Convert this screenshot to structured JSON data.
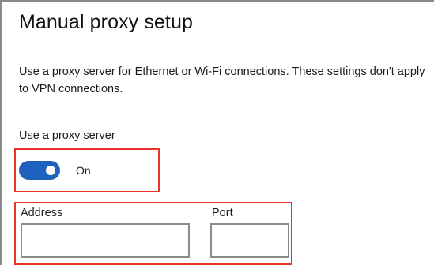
{
  "page": {
    "title": "Manual proxy setup",
    "description": "Use a proxy server for Ethernet or Wi-Fi connections. These settings don't apply to VPN connections."
  },
  "proxy_toggle": {
    "label": "Use a proxy server",
    "state_label": "On",
    "checked": true
  },
  "fields": {
    "address": {
      "label": "Address",
      "value": ""
    },
    "port": {
      "label": "Port",
      "value": ""
    }
  },
  "colors": {
    "toggle_on": "#1f62bd",
    "highlight": "#e8312a",
    "input_border": "#8c8c8c"
  },
  "icons": {
    "toggle_knob": "toggle-knob-icon"
  }
}
